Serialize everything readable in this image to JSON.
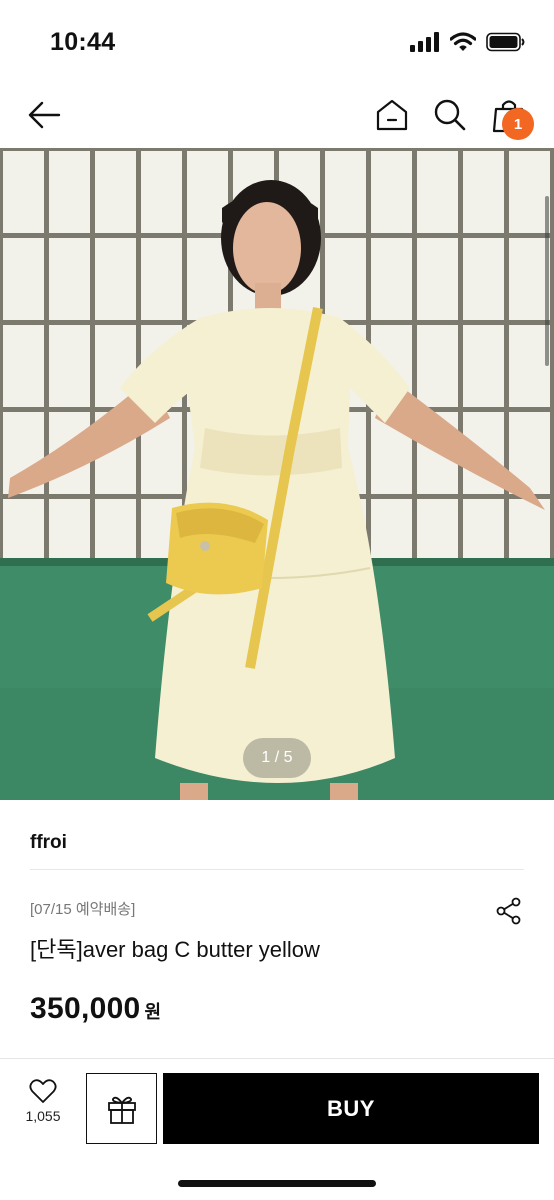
{
  "status_bar": {
    "time": "10:44",
    "icons": [
      "signal-icon",
      "wifi-icon",
      "battery-icon"
    ]
  },
  "nav": {
    "icons": [
      "back-arrow-icon",
      "home-icon",
      "search-icon",
      "shopping-bag-icon"
    ],
    "cart_count": "1",
    "badge_color": "#f26722"
  },
  "gallery": {
    "pager": "1 / 5"
  },
  "product": {
    "brand": "ffroi",
    "delivery_note": "[07/15 예약배송]",
    "title": "[단독]aver bag C butter yellow",
    "price": "350,000",
    "price_unit": "원",
    "share_icon": "share-icon"
  },
  "bottom_bar": {
    "like_count": "1,055",
    "like_icon": "heart-icon",
    "gift_icon": "gift-icon",
    "buy_label": "BUY"
  }
}
